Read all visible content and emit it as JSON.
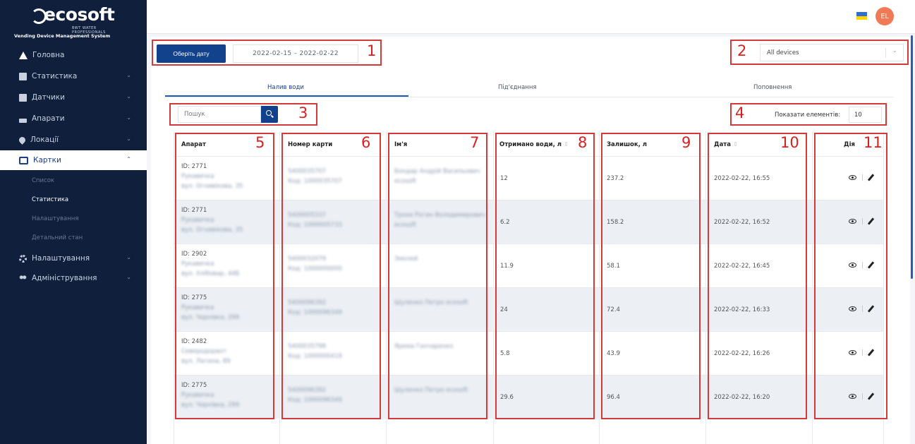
{
  "sidebar": {
    "brand": "ecosoft",
    "brand_tag": "BWT WATER PROFESSIONALS",
    "subtitle": "Vending Device Management System",
    "items": [
      {
        "label": "Головна"
      },
      {
        "label": "Статистика"
      },
      {
        "label": "Датчики"
      },
      {
        "label": "Апарати"
      },
      {
        "label": "Локації"
      },
      {
        "label": "Картки"
      },
      {
        "label": "Налаштування"
      },
      {
        "label": "Адміністрування"
      }
    ],
    "subitems": [
      {
        "label": "Список"
      },
      {
        "label": "Статистика"
      },
      {
        "label": "Налаштування"
      },
      {
        "label": "Детальний стан"
      }
    ]
  },
  "header": {
    "avatar_initials": "EL"
  },
  "toolbar": {
    "date_button": "Оберіть дату",
    "date_range": "2022-02-15 – 2022-02-22",
    "device_select": "All devices"
  },
  "tabs": [
    {
      "label": "Налив води"
    },
    {
      "label": "Під'єднання"
    },
    {
      "label": "Поповнення"
    }
  ],
  "search": {
    "placeholder": "Пошук"
  },
  "page_size": {
    "label": "Показати елементів:",
    "value": "10"
  },
  "table": {
    "headers": [
      "Апарат",
      "Номер карти",
      "Ім'я",
      "Отримано води, л",
      "Залишок, л",
      "Дата",
      "Дія"
    ],
    "rows": [
      {
        "device_id": "ID: 2771",
        "device_name": "Рукавичка",
        "device_addr": "вул. Огнивікова, 35",
        "card": "5400035707",
        "card_code": "Код: 1000035707",
        "name": "Бондар Андрій Васильович",
        "name2": "ecosoft",
        "water": "12",
        "balance": "237.2",
        "date": "2022-02-22, 16:55"
      },
      {
        "device_id": "ID: 2771",
        "device_name": "Рукавичка",
        "device_addr": "вул. Огнивікова, 35",
        "card": "5400005337",
        "card_code": "Код: 1000005733",
        "name": "Трохи Рогин Володимирович",
        "name2": "ecosoft",
        "water": "6.2",
        "balance": "158.2",
        "date": "2022-02-22, 16:52"
      },
      {
        "device_id": "ID: 2902",
        "device_name": "Рукавичка",
        "device_addr": "вул. Хлібовар, 44Б",
        "card": "5400032079",
        "card_code": "Код: 1000000000",
        "name": "Змолей",
        "name2": "",
        "water": "11.9",
        "balance": "58.1",
        "date": "2022-02-22, 16:45"
      },
      {
        "device_id": "ID: 2775",
        "device_name": "Рукавичка",
        "device_addr": "вул. Чорнівка, 299",
        "card": "5400096392",
        "card_code": "Код: 1000096349",
        "name": "Шуленко Петро ecosoft",
        "name2": "",
        "water": "24",
        "balance": "72.4",
        "date": "2022-02-22, 16:33"
      },
      {
        "device_id": "ID: 2482",
        "device_name": "Северодорант",
        "device_addr": "вул. Латана, 89",
        "card": "5400035798",
        "card_code": "Код: 1000000419",
        "name": "Ярема Гончаренко",
        "name2": "",
        "water": "5.8",
        "balance": "43.9",
        "date": "2022-02-22, 16:26"
      },
      {
        "device_id": "ID: 2775",
        "device_name": "Рукавичка",
        "device_addr": "вул. Чорнівка, 299",
        "card": "5400096392",
        "card_code": "Код: 1000096349",
        "name": "Шуленко Петро ecosoft",
        "name2": "",
        "water": "29.6",
        "balance": "96.4",
        "date": "2022-02-22, 16:20"
      }
    ]
  },
  "annotations": [
    "1",
    "2",
    "3",
    "4",
    "5",
    "6",
    "7",
    "8",
    "9",
    "10",
    "11"
  ],
  "colors": {
    "sidebar": "#0f1f3c",
    "primary": "#12428c",
    "annotation": "#d43a3a",
    "avatar": "#f07956"
  }
}
